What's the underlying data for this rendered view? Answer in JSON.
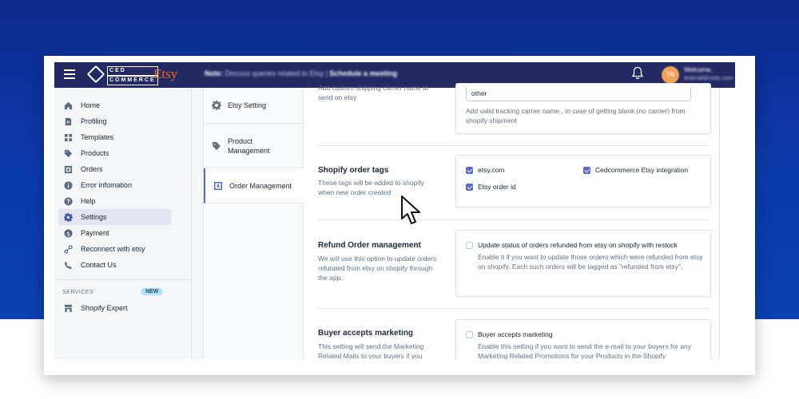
{
  "header": {
    "logo_top": "CED",
    "logo_bottom": "COMMERCE",
    "logo_brand": "Etsy",
    "note_label": "Note:",
    "note_text": "Discuss queries related to Etsy |",
    "note_link": "Schedule a meeting",
    "avatar_initials": "TN",
    "welcome": "Welcome,",
    "email": "testmail@cedc.com"
  },
  "sidebar": {
    "items": [
      {
        "label": "Home",
        "icon": "home-icon"
      },
      {
        "label": "Profiling",
        "icon": "profiling-icon"
      },
      {
        "label": "Templates",
        "icon": "templates-icon"
      },
      {
        "label": "Products",
        "icon": "tag-icon"
      },
      {
        "label": "Orders",
        "icon": "orders-icon"
      },
      {
        "label": "Error infomation",
        "icon": "info-icon"
      },
      {
        "label": "Help",
        "icon": "help-icon"
      },
      {
        "label": "Settings",
        "icon": "gear-icon"
      },
      {
        "label": "Payment",
        "icon": "dollar-icon"
      },
      {
        "label": "Reconnect with etsy",
        "icon": "link-icon"
      },
      {
        "label": "Contact Us",
        "icon": "phone-icon"
      }
    ],
    "active": "Settings",
    "services_label": "SERVICES",
    "new_badge": "NEW",
    "service_item": "Shopify Expert"
  },
  "tabs": [
    {
      "label": "Etsy Setting",
      "icon": "gear-icon"
    },
    {
      "label": "Product Management",
      "icon": "tag-icon"
    },
    {
      "label": "Order Management",
      "icon": "download-icon"
    }
  ],
  "main": {
    "top_desc": "Add custom shipping carrier name to send on etsy",
    "carrier_value": "other",
    "carrier_help": "Add valid tracking carrier name , in case of getting blank (no carrier) from shopify shipment",
    "tags": {
      "title": "Shopify order tags",
      "desc": "These tags will be added to shopify when new order created",
      "options": [
        {
          "label": "etsy.com",
          "checked": true
        },
        {
          "label": "Cedcommerce Etsy integration",
          "checked": true
        },
        {
          "label": "Etsy order id",
          "checked": true
        }
      ]
    },
    "refund": {
      "title": "Refund Order management",
      "desc": "We will use this option to update orders refunded from etsy on shopify through the app.",
      "option_label": "Update status of orders refunded from etsy on shopify with restock",
      "help": "Enable it if you want to update those orders which were refunded from etsy on shopify. Each such orders will be tagged as \"refunded from etsy\"."
    },
    "marketing": {
      "title": "Buyer accepts marketing",
      "desc": "This setting will send the Marketing Related Mails to your buyers if you",
      "option_label": "Buyer accepts marketing",
      "help": "Enable this setting if you want to send the e-mail to your buyers for any Marketing Related Promotions for your Products in the Shopify"
    }
  }
}
